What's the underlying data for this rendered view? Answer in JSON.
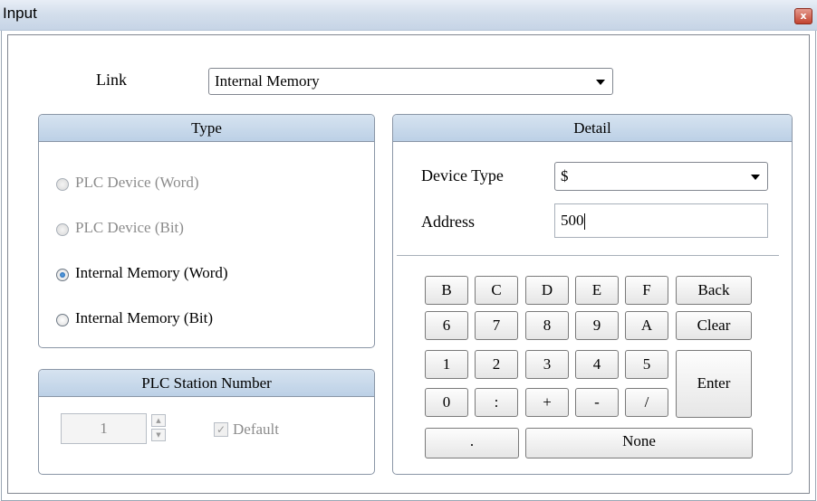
{
  "window": {
    "title": "Input",
    "close_glyph": "x"
  },
  "link": {
    "label": "Link",
    "value": "Internal Memory"
  },
  "type_group": {
    "title": "Type",
    "options": [
      {
        "label": "PLC Device (Word)",
        "enabled": false,
        "selected": false
      },
      {
        "label": "PLC Device (Bit)",
        "enabled": false,
        "selected": false
      },
      {
        "label": "Internal Memory (Word)",
        "enabled": true,
        "selected": true
      },
      {
        "label": "Internal Memory (Bit)",
        "enabled": true,
        "selected": false
      }
    ]
  },
  "station_group": {
    "title": "PLC Station Number",
    "value": "1",
    "default_label": "Default",
    "default_checked": true
  },
  "detail_group": {
    "title": "Detail",
    "device_type_label": "Device Type",
    "device_type_value": "$",
    "address_label": "Address",
    "address_value": "500"
  },
  "keypad": {
    "row1": [
      "B",
      "C",
      "D",
      "E",
      "F",
      "Back"
    ],
    "row2": [
      "6",
      "7",
      "8",
      "9",
      "A",
      "Clear"
    ],
    "row3": [
      "1",
      "2",
      "3",
      "4",
      "5"
    ],
    "row4": [
      "0",
      ":",
      "+",
      "-",
      "/"
    ],
    "enter": "Enter",
    "dot": ".",
    "none": "None"
  },
  "icons": {
    "close": "close-icon",
    "dropdown": "chevron-down-icon",
    "spin_up": "spin-up-icon",
    "spin_down": "spin-down-icon",
    "check": "checkmark-icon"
  },
  "colors": {
    "group_header": "#c9d9ea",
    "radio_selected": "#1c5fa8",
    "close_button": "#c2432f"
  }
}
